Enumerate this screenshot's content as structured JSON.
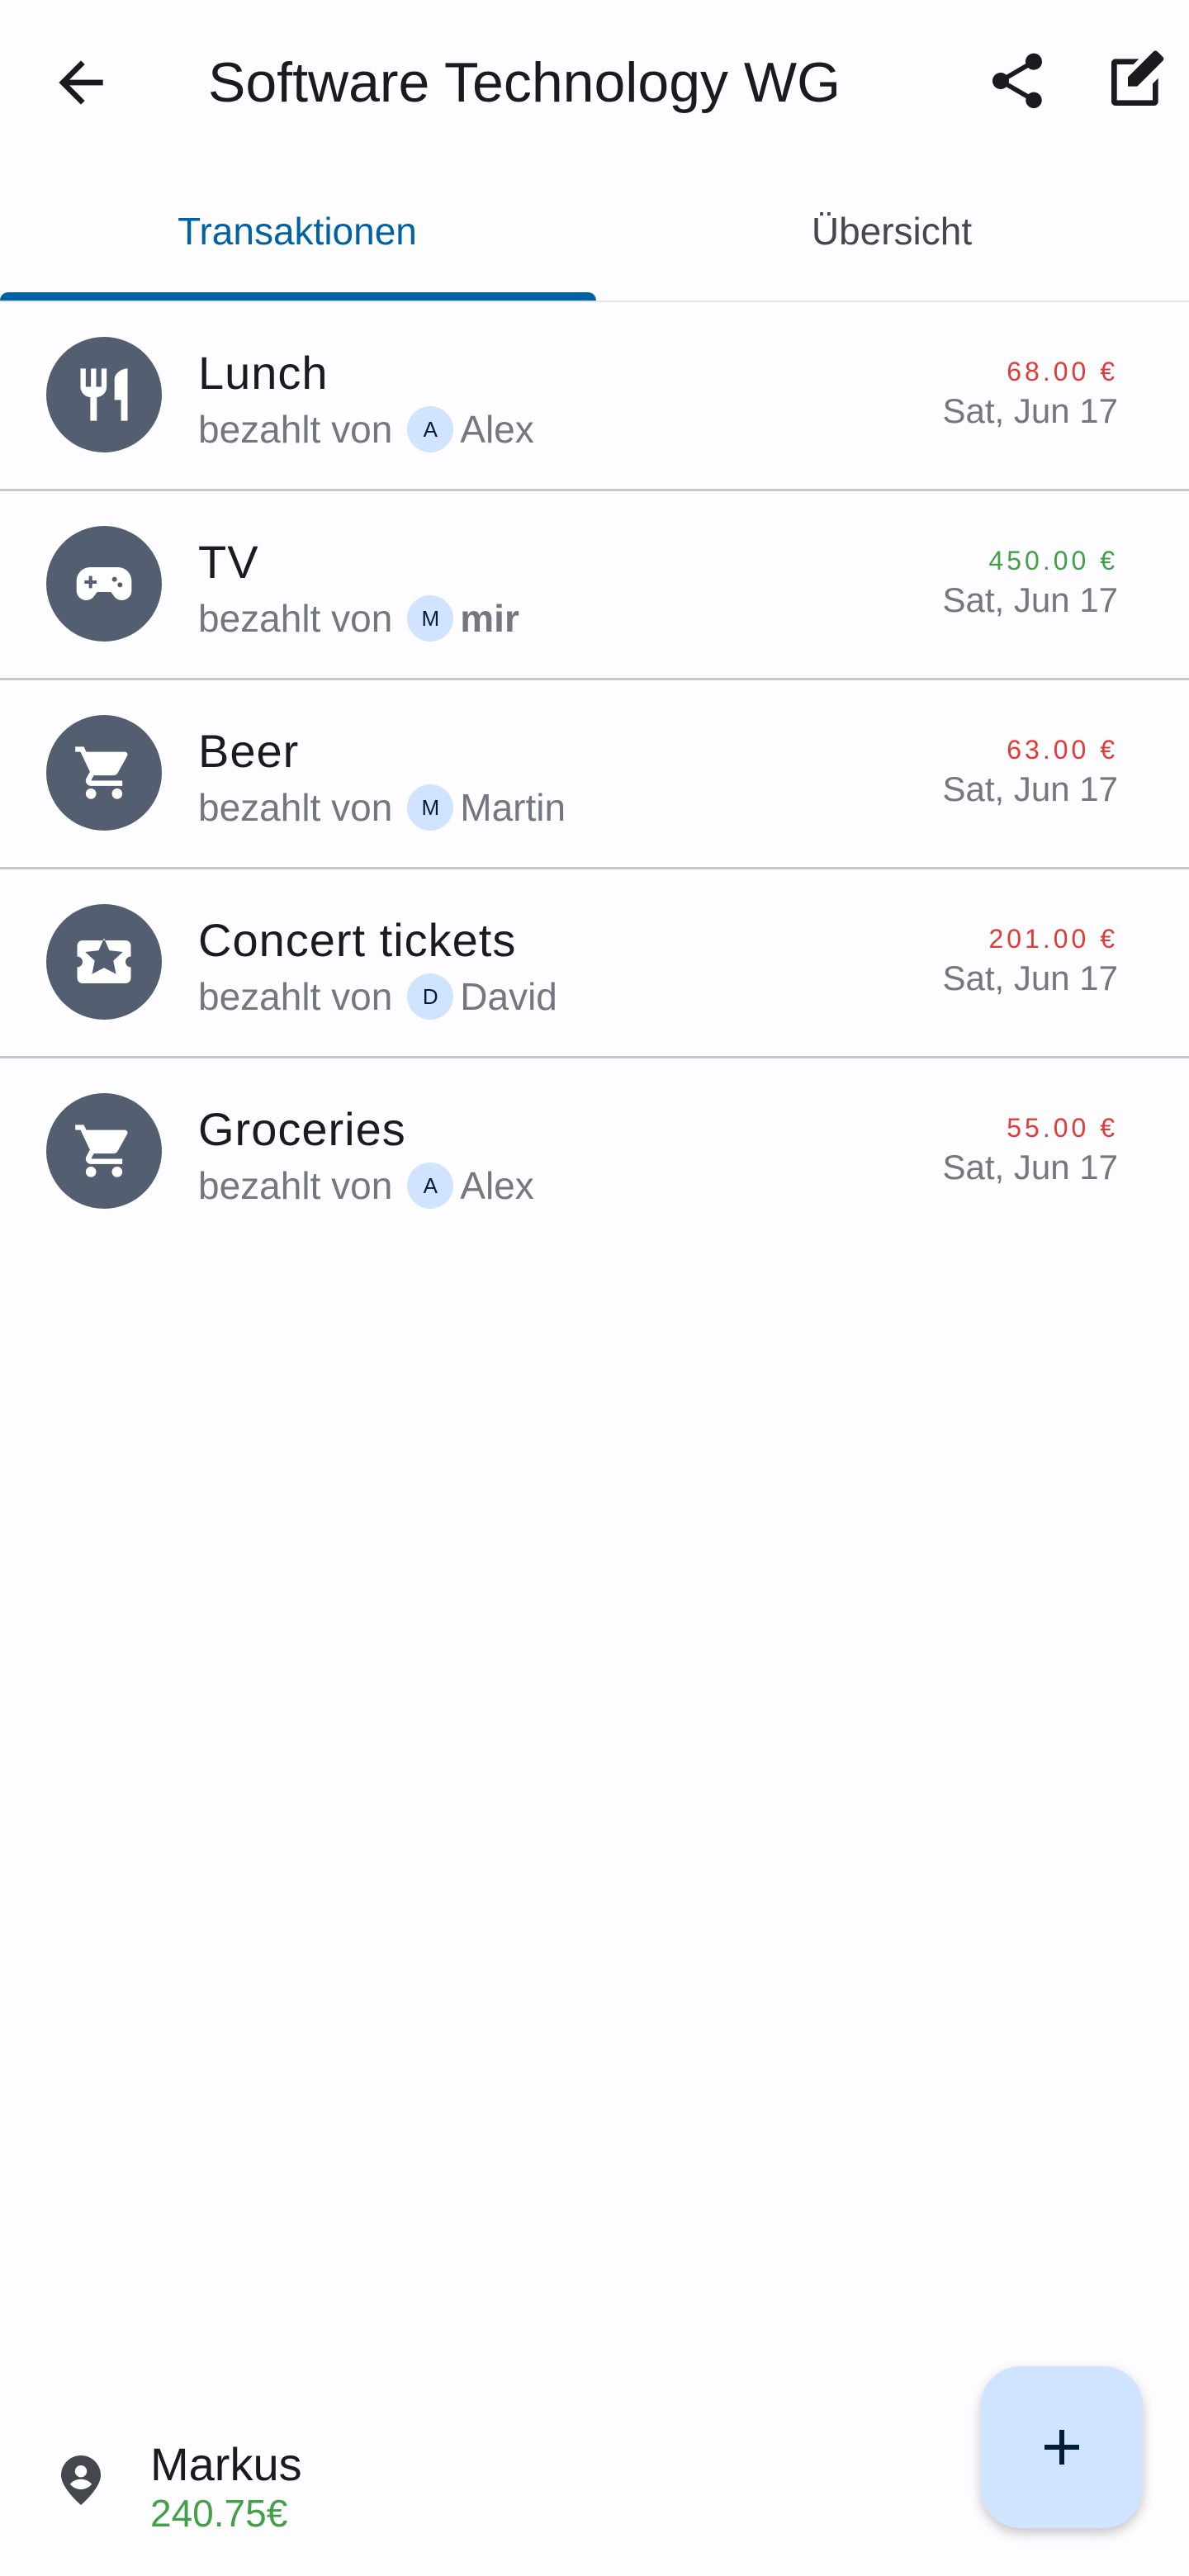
{
  "header": {
    "title": "Software Technology WG",
    "back_icon": "arrow-back-icon",
    "share_icon": "share-icon",
    "edit_icon": "edit-icon"
  },
  "tabs": [
    {
      "label": "Transaktionen",
      "active": true
    },
    {
      "label": "Übersicht",
      "active": false
    }
  ],
  "transactions": [
    {
      "title": "Lunch",
      "paid_by_label": "bezahlt von",
      "payer_initial": "A",
      "payer": "Alex",
      "payer_is_self": false,
      "amount": "68.00 €",
      "amount_sign": "negative",
      "date": "Sat, Jun 17",
      "icon": "restaurant-icon"
    },
    {
      "title": "TV",
      "paid_by_label": "bezahlt von",
      "payer_initial": "M",
      "payer": "mir",
      "payer_is_self": true,
      "amount": "450.00 €",
      "amount_sign": "positive",
      "date": "Sat, Jun 17",
      "icon": "gamepad-icon"
    },
    {
      "title": "Beer",
      "paid_by_label": "bezahlt von",
      "payer_initial": "M",
      "payer": "Martin",
      "payer_is_self": false,
      "amount": "63.00 €",
      "amount_sign": "negative",
      "date": "Sat, Jun 17",
      "icon": "shopping-cart-icon"
    },
    {
      "title": "Concert tickets",
      "paid_by_label": "bezahlt von",
      "payer_initial": "D",
      "payer": "David",
      "payer_is_self": false,
      "amount": "201.00 €",
      "amount_sign": "negative",
      "date": "Sat, Jun 17",
      "icon": "ticket-icon"
    },
    {
      "title": "Groceries",
      "paid_by_label": "bezahlt von",
      "payer_initial": "A",
      "payer": "Alex",
      "payer_is_self": false,
      "amount": "55.00 €",
      "amount_sign": "negative",
      "date": "Sat, Jun 17",
      "icon": "shopping-cart-icon"
    }
  ],
  "footer": {
    "user_name": "Markus",
    "balance": "240.75€",
    "user_icon": "account-pin-icon"
  },
  "fab": {
    "icon": "add-icon"
  },
  "colors": {
    "accent": "#0061a4",
    "negative": "#e53935",
    "positive": "#43a047",
    "avatar_bg": "#535f70",
    "mini_avatar_bg": "#d1e4ff",
    "fab_bg": "#d1e4ff"
  }
}
